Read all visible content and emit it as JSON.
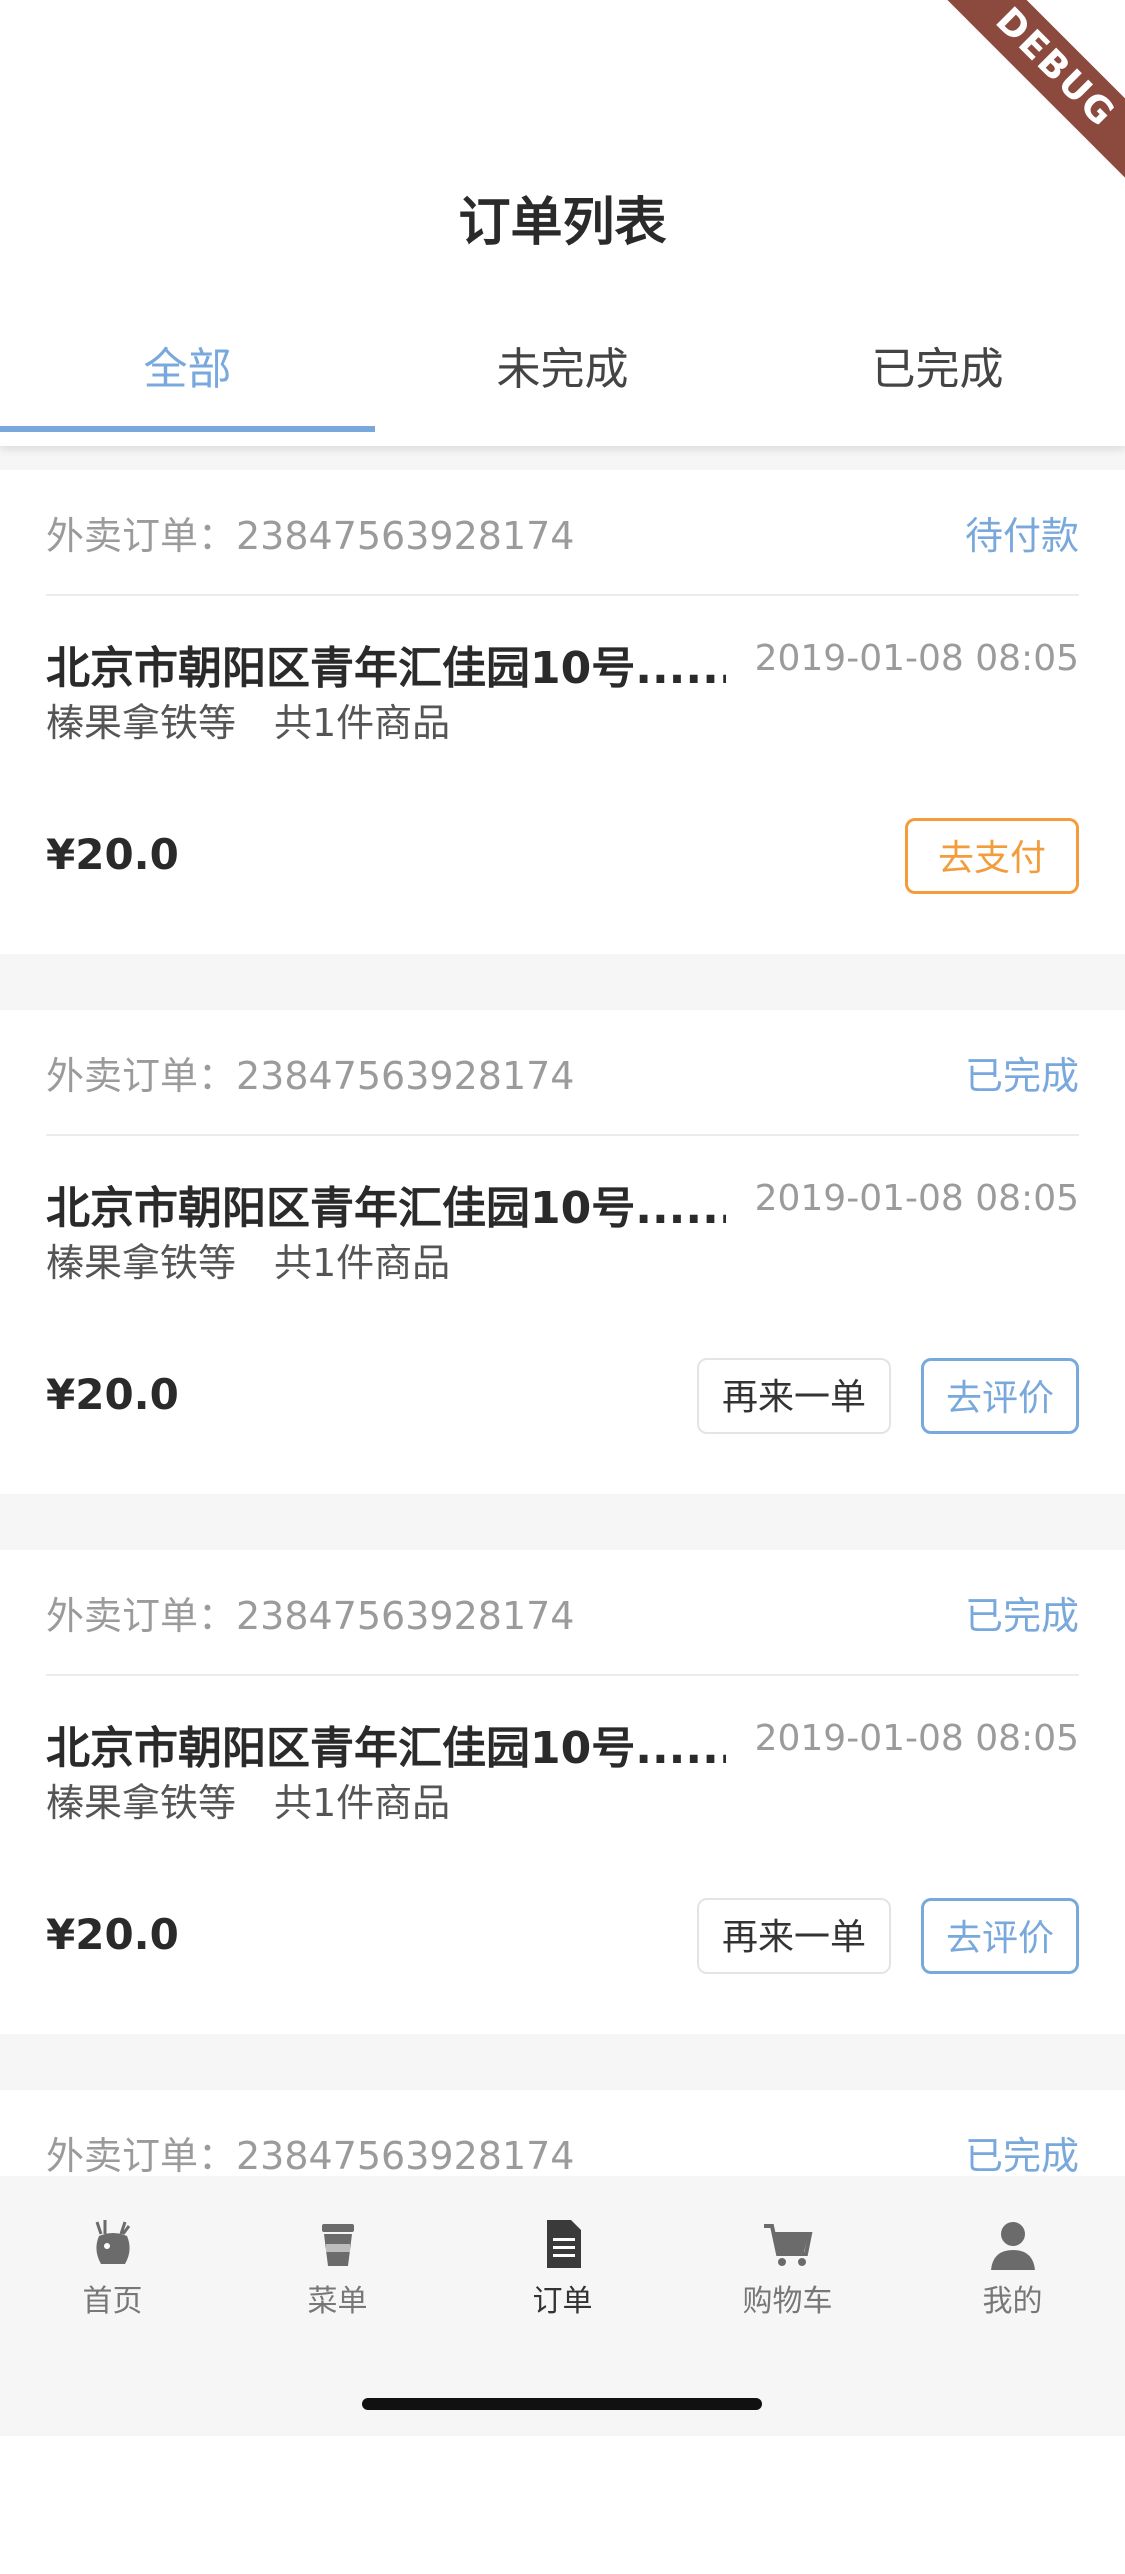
{
  "debug_banner": "DEBUG",
  "header": {
    "title": "订单列表"
  },
  "tabs": [
    {
      "label": "全部",
      "active": true
    },
    {
      "label": "未完成",
      "active": false
    },
    {
      "label": "已完成",
      "active": false
    }
  ],
  "orders": [
    {
      "order_label": "外卖订单：23847563928174",
      "status": "待付款",
      "address": "北京市朝阳区青年汇佳园10号......",
      "time": "2019-01-08 08:05",
      "goods": "榛果拿铁等　共1件商品",
      "price": "¥20.0",
      "actions": [
        "去支付"
      ]
    },
    {
      "order_label": "外卖订单：23847563928174",
      "status": "已完成",
      "address": "北京市朝阳区青年汇佳园10号......",
      "time": "2019-01-08 08:05",
      "goods": "榛果拿铁等　共1件商品",
      "price": "¥20.0",
      "actions": [
        "再来一单",
        "去评价"
      ]
    },
    {
      "order_label": "外卖订单：23847563928174",
      "status": "已完成",
      "address": "北京市朝阳区青年汇佳园10号......",
      "time": "2019-01-08 08:05",
      "goods": "榛果拿铁等　共1件商品",
      "price": "¥20.0",
      "actions": [
        "再来一单",
        "去评价"
      ]
    },
    {
      "order_label": "外卖订单：23847563928174",
      "status": "已完成"
    }
  ],
  "tabbar": [
    {
      "label": "首页",
      "icon": "deer-icon",
      "active": false
    },
    {
      "label": "菜单",
      "icon": "coffee-cup-icon",
      "active": false
    },
    {
      "label": "订单",
      "icon": "document-icon",
      "active": true
    },
    {
      "label": "购物车",
      "icon": "cart-icon",
      "active": false
    },
    {
      "label": "我的",
      "icon": "person-icon",
      "active": false
    }
  ],
  "colors": {
    "accent": "#79a9dc",
    "pay": "#f39c3c",
    "debug": "#8b4a3d"
  }
}
